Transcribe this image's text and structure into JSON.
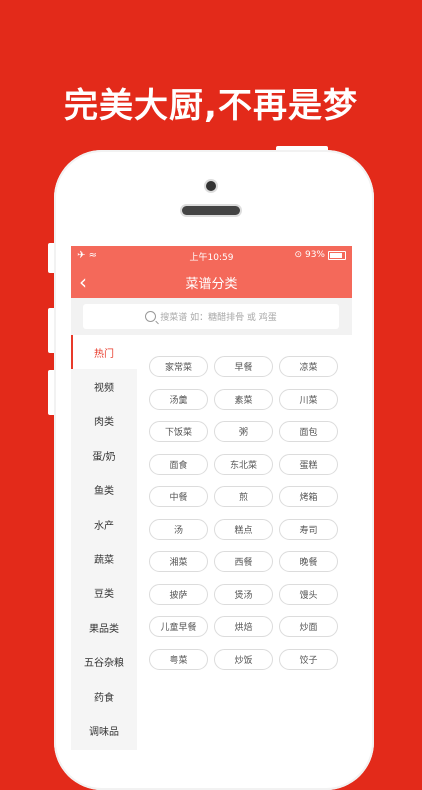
{
  "headline": "完美大厨,不再是梦",
  "status_bar": {
    "signal": "✈",
    "wifi": "≈",
    "time": "上午10:59",
    "battery_pct": "93%"
  },
  "nav": {
    "back_icon": "chevron-left-icon",
    "title": "菜谱分类"
  },
  "search": {
    "placeholder": "搜菜谱 如：糖醋排骨 或 鸡蛋"
  },
  "sidebar": {
    "items": [
      {
        "label": "热门",
        "active": true
      },
      {
        "label": "视频"
      },
      {
        "label": "肉类"
      },
      {
        "label": "蛋/奶"
      },
      {
        "label": "鱼类"
      },
      {
        "label": "水产"
      },
      {
        "label": "蔬菜"
      },
      {
        "label": "豆类"
      },
      {
        "label": "果品类"
      },
      {
        "label": "五谷杂粮"
      },
      {
        "label": "药食"
      },
      {
        "label": "调味品"
      }
    ]
  },
  "tags": [
    "家常菜",
    "早餐",
    "凉菜",
    "汤羹",
    "素菜",
    "川菜",
    "下饭菜",
    "粥",
    "面包",
    "面食",
    "东北菜",
    "蛋糕",
    "中餐",
    "煎",
    "烤箱",
    "汤",
    "糕点",
    "寿司",
    "湘菜",
    "西餐",
    "晚餐",
    "披萨",
    "煲汤",
    "馒头",
    "儿童早餐",
    "烘焙",
    "炒面",
    "粤菜",
    "炒饭",
    "饺子"
  ],
  "colors": {
    "background": "#e32a1a",
    "accent": "#f4695a",
    "active_text": "#e83a2a"
  }
}
